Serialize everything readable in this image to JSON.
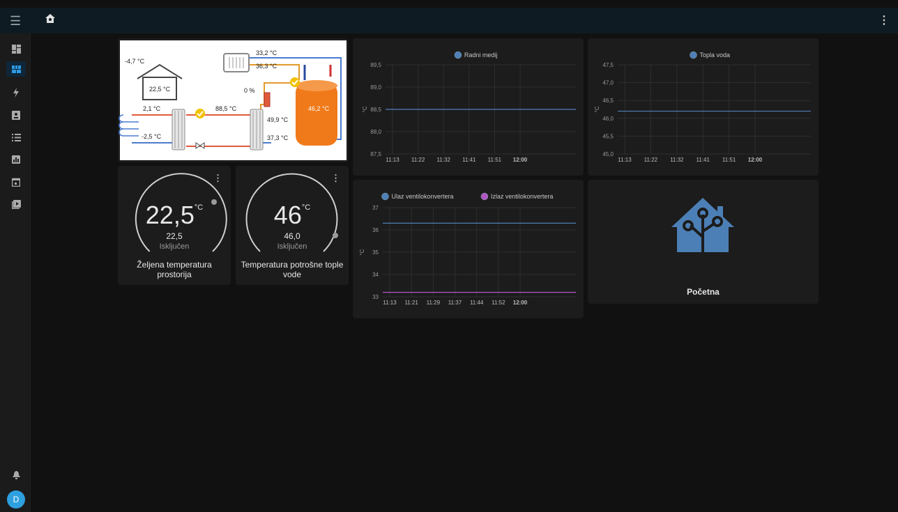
{
  "app": {
    "menu_icon": "menu-icon",
    "home_icon": "home-icon",
    "more_icon": "more-vert-icon"
  },
  "sidebar": {
    "items": [
      {
        "icon": "overview-icon",
        "active": false
      },
      {
        "icon": "dashboard-icon",
        "active": true
      },
      {
        "icon": "energy-icon",
        "active": false
      },
      {
        "icon": "map-icon",
        "active": false
      },
      {
        "icon": "logbook-icon",
        "active": false
      },
      {
        "icon": "history-icon",
        "active": false
      },
      {
        "icon": "calendar-icon",
        "active": false
      },
      {
        "icon": "media-icon",
        "active": false
      }
    ],
    "notifications_icon": "bell-icon",
    "avatar": "D"
  },
  "diagram": {
    "outdoor": "-4,7 °C",
    "indoor": "22,5 °C",
    "t1": "33,2 °C",
    "t2": "36,3 °C",
    "valve": "0 %",
    "tank": "46,2 °C",
    "hp_in": "2,1 °C",
    "hp_out": "-2,5 °C",
    "mid": "88,5 °C",
    "t3": "49,9 °C",
    "t4": "37,3 °C"
  },
  "thermostat1": {
    "target": "22,5",
    "unit": "°C",
    "current": "22,5",
    "state": "Isključen",
    "name_line1": "Željena temperatura",
    "name_line2": "prostorija"
  },
  "thermostat2": {
    "target": "46",
    "unit": "°C",
    "current": "46,0",
    "state": "Isključen",
    "name_line1": "Temperatura potrošne tople",
    "name_line2": "vode"
  },
  "logo_card": {
    "label": "Početna"
  },
  "chart_data": [
    {
      "type": "line",
      "x": [
        "11:13",
        "11:22",
        "11:32",
        "11:41",
        "11:51",
        "12:00"
      ],
      "series": [
        {
          "name": "Radni medij",
          "color": "#4f7fb7",
          "values": [
            88.5,
            88.5,
            88.5,
            88.5,
            88.5,
            88.5
          ]
        }
      ],
      "ylabel": "°C",
      "ylim": [
        87.5,
        89.5
      ],
      "yticks": [
        "87,5",
        "88,0",
        "88,5",
        "89,0",
        "89,5"
      ],
      "grid": true,
      "legend": "top"
    },
    {
      "type": "line",
      "x": [
        "11:13",
        "11:22",
        "11:32",
        "11:41",
        "11:51",
        "12:00"
      ],
      "series": [
        {
          "name": "Topla voda",
          "color": "#4f7fb7",
          "values": [
            46.2,
            46.2,
            46.2,
            46.2,
            46.2,
            46.2
          ]
        }
      ],
      "ylabel": "°C",
      "ylim": [
        45.0,
        47.5
      ],
      "yticks": [
        "45,0",
        "45,5",
        "46,0",
        "46,5",
        "47,0",
        "47,5"
      ],
      "grid": true,
      "legend": "top"
    },
    {
      "type": "line",
      "x": [
        "11:13",
        "11:21",
        "11:29",
        "11:37",
        "11:44",
        "11:52",
        "12:00"
      ],
      "series": [
        {
          "name": "Ulaz ventilokonvertera",
          "color": "#4f7fb7",
          "values": [
            36.3,
            36.3,
            36.3,
            36.3,
            36.3,
            36.3,
            36.3
          ]
        },
        {
          "name": "Izlaz ventilokonvertera",
          "color": "#b056c5",
          "values": [
            33.2,
            33.2,
            33.2,
            33.2,
            33.2,
            33.2,
            33.2
          ]
        }
      ],
      "ylabel": "°C",
      "ylim": [
        33,
        37
      ],
      "yticks": [
        "33",
        "34",
        "35",
        "36",
        "37"
      ],
      "grid": true,
      "legend": "top"
    }
  ]
}
